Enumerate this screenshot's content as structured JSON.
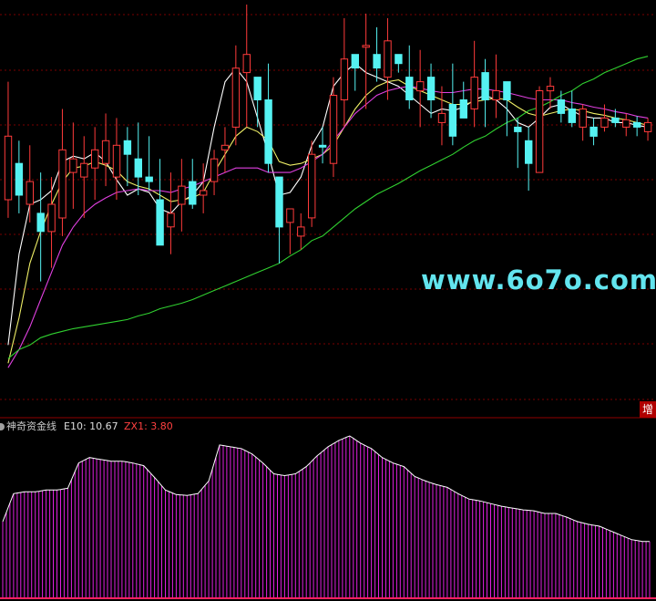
{
  "watermark": "www.6o7o.com",
  "badge": "增",
  "indicator": {
    "name": "神奇资金线",
    "e10_label": "E10: 10.67",
    "zx1_label": "ZX1: 3.80",
    "colors": {
      "bars": "#e020e0",
      "envelope": "#ffffff",
      "baseline": "#ff2060",
      "e10": "#dcdcdc",
      "zx1": "#ff4040"
    }
  },
  "colors": {
    "background": "#000000",
    "grid": "#7a0000",
    "up_candle": "#ff3b3b",
    "down_candle": "#55f2f2",
    "ma_white": "#ffffff",
    "ma_yellow": "#eeee66",
    "ma_magenta": "#e040e0",
    "ma_green": "#30d030"
  },
  "chart_data": [
    {
      "type": "candlestick",
      "title": "",
      "ylim": [
        0,
        440
      ],
      "candles": [
        {
          "o": 220,
          "h": 350,
          "l": 200,
          "c": 290,
          "up": true
        },
        {
          "o": 260,
          "h": 285,
          "l": 205,
          "c": 225,
          "up": false
        },
        {
          "o": 215,
          "h": 280,
          "l": 195,
          "c": 240,
          "up": true
        },
        {
          "o": 205,
          "h": 250,
          "l": 130,
          "c": 185,
          "up": false
        },
        {
          "o": 185,
          "h": 245,
          "l": 145,
          "c": 215,
          "up": true
        },
        {
          "o": 200,
          "h": 320,
          "l": 180,
          "c": 275,
          "up": true
        },
        {
          "o": 250,
          "h": 305,
          "l": 210,
          "c": 265,
          "up": true
        },
        {
          "o": 245,
          "h": 290,
          "l": 200,
          "c": 260,
          "up": true
        },
        {
          "o": 255,
          "h": 300,
          "l": 220,
          "c": 275,
          "up": true
        },
        {
          "o": 260,
          "h": 315,
          "l": 235,
          "c": 285,
          "up": true
        },
        {
          "o": 245,
          "h": 310,
          "l": 220,
          "c": 280,
          "up": true
        },
        {
          "o": 285,
          "h": 300,
          "l": 235,
          "c": 270,
          "up": false
        },
        {
          "o": 265,
          "h": 305,
          "l": 225,
          "c": 245,
          "up": false
        },
        {
          "o": 245,
          "h": 290,
          "l": 230,
          "c": 240,
          "up": false
        },
        {
          "o": 220,
          "h": 265,
          "l": 175,
          "c": 170,
          "up": false
        },
        {
          "o": 205,
          "h": 250,
          "l": 160,
          "c": 190,
          "up": true
        },
        {
          "o": 215,
          "h": 265,
          "l": 185,
          "c": 235,
          "up": true
        },
        {
          "o": 240,
          "h": 265,
          "l": 210,
          "c": 215,
          "up": false
        },
        {
          "o": 225,
          "h": 260,
          "l": 205,
          "c": 230,
          "up": true
        },
        {
          "o": 240,
          "h": 275,
          "l": 225,
          "c": 265,
          "up": true
        },
        {
          "o": 275,
          "h": 300,
          "l": 250,
          "c": 280,
          "up": true
        },
        {
          "o": 300,
          "h": 390,
          "l": 280,
          "c": 365,
          "up": true
        },
        {
          "o": 360,
          "h": 435,
          "l": 300,
          "c": 380,
          "up": true
        },
        {
          "o": 355,
          "h": 340,
          "l": 300,
          "c": 330,
          "up": false
        },
        {
          "o": 330,
          "h": 370,
          "l": 250,
          "c": 260,
          "up": false
        },
        {
          "o": 245,
          "h": 230,
          "l": 150,
          "c": 190,
          "up": false
        },
        {
          "o": 210,
          "h": 200,
          "l": 160,
          "c": 195,
          "up": true
        },
        {
          "o": 180,
          "h": 205,
          "l": 165,
          "c": 190,
          "up": true
        },
        {
          "o": 200,
          "h": 285,
          "l": 190,
          "c": 270,
          "up": true
        },
        {
          "o": 280,
          "h": 300,
          "l": 260,
          "c": 278,
          "up": false
        },
        {
          "o": 260,
          "h": 355,
          "l": 245,
          "c": 335,
          "up": true
        },
        {
          "o": 330,
          "h": 420,
          "l": 300,
          "c": 375,
          "up": true
        },
        {
          "o": 380,
          "h": 375,
          "l": 340,
          "c": 365,
          "up": false
        },
        {
          "o": 390,
          "h": 425,
          "l": 320,
          "c": 390,
          "up": true
        },
        {
          "o": 380,
          "h": 410,
          "l": 350,
          "c": 365,
          "up": false
        },
        {
          "o": 355,
          "h": 420,
          "l": 330,
          "c": 395,
          "up": true
        },
        {
          "o": 380,
          "h": 375,
          "l": 360,
          "c": 370,
          "up": false
        },
        {
          "o": 355,
          "h": 390,
          "l": 320,
          "c": 330,
          "up": false
        },
        {
          "o": 340,
          "h": 385,
          "l": 300,
          "c": 350,
          "up": true
        },
        {
          "o": 355,
          "h": 370,
          "l": 310,
          "c": 330,
          "up": false
        },
        {
          "o": 305,
          "h": 345,
          "l": 280,
          "c": 315,
          "up": true
        },
        {
          "o": 290,
          "h": 370,
          "l": 280,
          "c": 325,
          "up": false
        },
        {
          "o": 330,
          "h": 350,
          "l": 310,
          "c": 310,
          "up": false
        },
        {
          "o": 320,
          "h": 395,
          "l": 300,
          "c": 355,
          "up": true
        },
        {
          "o": 360,
          "h": 375,
          "l": 300,
          "c": 330,
          "up": false
        },
        {
          "o": 330,
          "h": 380,
          "l": 310,
          "c": 340,
          "up": true
        },
        {
          "o": 350,
          "h": 345,
          "l": 290,
          "c": 330,
          "up": false
        },
        {
          "o": 300,
          "h": 310,
          "l": 255,
          "c": 295,
          "up": false
        },
        {
          "o": 285,
          "h": 300,
          "l": 230,
          "c": 260,
          "up": false
        },
        {
          "o": 250,
          "h": 345,
          "l": 250,
          "c": 340,
          "up": true
        },
        {
          "o": 340,
          "h": 355,
          "l": 320,
          "c": 345,
          "up": true
        },
        {
          "o": 330,
          "h": 340,
          "l": 305,
          "c": 315,
          "up": false
        },
        {
          "o": 320,
          "h": 340,
          "l": 300,
          "c": 305,
          "up": false
        },
        {
          "o": 300,
          "h": 325,
          "l": 285,
          "c": 320,
          "up": true
        },
        {
          "o": 290,
          "h": 310,
          "l": 280,
          "c": 300,
          "up": false
        },
        {
          "o": 300,
          "h": 325,
          "l": 295,
          "c": 310,
          "up": true
        },
        {
          "o": 305,
          "h": 320,
          "l": 300,
          "c": 310,
          "up": false
        },
        {
          "o": 300,
          "h": 315,
          "l": 290,
          "c": 308,
          "up": true
        },
        {
          "o": 305,
          "h": 312,
          "l": 290,
          "c": 300,
          "up": false
        },
        {
          "o": 295,
          "h": 310,
          "l": 285,
          "c": 305,
          "up": true
        }
      ],
      "ma_lines": [
        {
          "color": "white",
          "values": [
            60,
            160,
            215,
            220,
            230,
            262,
            268,
            265,
            272,
            262,
            242,
            225,
            232,
            228,
            210,
            205,
            218,
            225,
            240,
            300,
            350,
            365,
            350,
            310,
            270,
            225,
            228,
            245,
            280,
            300,
            345,
            360,
            370,
            360,
            355,
            350,
            345,
            335,
            325,
            315,
            320,
            318,
            322,
            330,
            335,
            330,
            320,
            305,
            300,
            310,
            322,
            325,
            318,
            312,
            310,
            310,
            305,
            305,
            302,
            300
          ]
        },
        {
          "color": "yellow",
          "values": [
            40,
            90,
            150,
            185,
            215,
            240,
            255,
            257,
            262,
            258,
            252,
            240,
            235,
            232,
            225,
            218,
            220,
            222,
            228,
            250,
            270,
            290,
            300,
            295,
            285,
            262,
            258,
            260,
            265,
            270,
            280,
            300,
            320,
            335,
            345,
            350,
            352,
            345,
            340,
            335,
            330,
            325,
            325,
            328,
            330,
            332,
            330,
            322,
            315,
            312,
            315,
            318,
            320,
            318,
            315,
            313,
            310,
            308,
            305,
            302
          ]
        },
        {
          "color": "magenta",
          "values": [
            35,
            55,
            80,
            110,
            140,
            170,
            190,
            205,
            215,
            222,
            228,
            230,
            232,
            230,
            230,
            228,
            232,
            235,
            240,
            245,
            250,
            255,
            255,
            255,
            250,
            250,
            250,
            255,
            262,
            270,
            285,
            300,
            315,
            325,
            335,
            340,
            343,
            345,
            343,
            340,
            338,
            338,
            340,
            342,
            342,
            340,
            338,
            335,
            332,
            330,
            330,
            330,
            327,
            325,
            322,
            320,
            317,
            315,
            312,
            310
          ]
        },
        {
          "color": "green",
          "values": [
            45,
            55,
            60,
            68,
            72,
            75,
            78,
            80,
            82,
            84,
            86,
            88,
            92,
            95,
            100,
            103,
            106,
            110,
            115,
            120,
            125,
            130,
            135,
            140,
            145,
            150,
            158,
            165,
            175,
            180,
            190,
            200,
            210,
            218,
            226,
            232,
            238,
            245,
            252,
            258,
            264,
            270,
            278,
            285,
            290,
            298,
            305,
            310,
            318,
            322,
            328,
            335,
            340,
            348,
            353,
            360,
            365,
            370,
            375,
            378
          ]
        }
      ]
    },
    {
      "type": "bar",
      "title": "神奇资金线",
      "ylim": [
        0,
        180
      ],
      "values": [
        85,
        116,
        118,
        118,
        120,
        120,
        122,
        150,
        156,
        154,
        152,
        152,
        150,
        147,
        134,
        120,
        115,
        114,
        116,
        130,
        170,
        168,
        166,
        160,
        150,
        138,
        136,
        138,
        146,
        158,
        168,
        175,
        180,
        172,
        166,
        156,
        150,
        146,
        135,
        130,
        126,
        123,
        116,
        110,
        108,
        105,
        102,
        100,
        98,
        97,
        94,
        94,
        90,
        85,
        82,
        80,
        75,
        70,
        65,
        63
      ]
    }
  ]
}
